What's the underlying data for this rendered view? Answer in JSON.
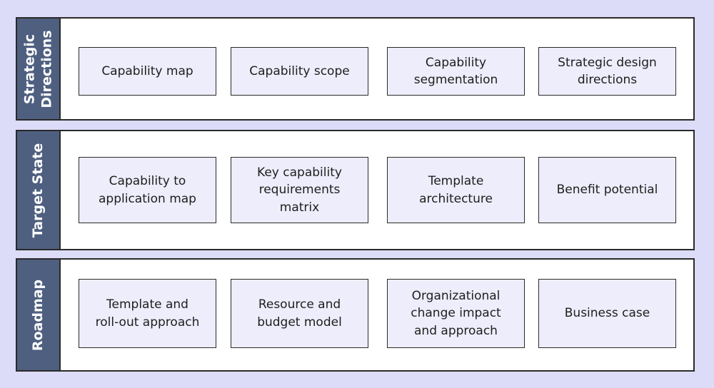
{
  "colors": {
    "background": "#dcdcf8",
    "sidebar": "#4f5f80",
    "panel": "#ffffff",
    "item_fill": "#ededfb",
    "border": "#2a2a2a",
    "sidebar_text": "#ffffff",
    "item_text": "#1e1e1e"
  },
  "rows": [
    {
      "label": "Strategic\nDirections",
      "items": [
        "Capability map",
        "Capability scope",
        "Capability\nsegmentation",
        "Strategic design\ndirections"
      ]
    },
    {
      "label": "Target State",
      "items": [
        "Capability to\napplication map",
        "Key capability\nrequirements\nmatrix",
        "Template\narchitecture",
        "Benefit potential"
      ]
    },
    {
      "label": "Roadmap",
      "items": [
        "Template and\nroll-out approach",
        "Resource and\nbudget model",
        "Organizational\nchange impact\nand approach",
        "Business case"
      ]
    }
  ]
}
